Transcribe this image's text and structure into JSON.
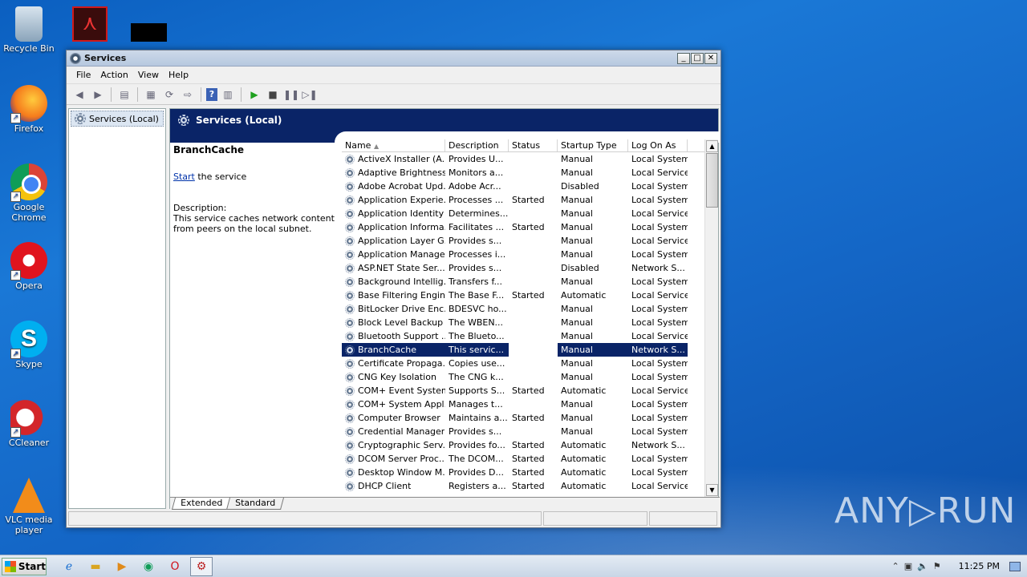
{
  "desktop": {
    "icons": [
      {
        "label": "Recycle Bin"
      },
      {
        "label": "Firefox"
      },
      {
        "label": "Google Chrome"
      },
      {
        "label": "Opera"
      },
      {
        "label": "Skype"
      },
      {
        "label": "CCleaner"
      },
      {
        "label": "VLC media player"
      }
    ],
    "watermark": "ANY▷RUN"
  },
  "window": {
    "title": "Services",
    "menu": [
      "File",
      "Action",
      "View",
      "Help"
    ],
    "tree_root": "Services (Local)",
    "pane_title": "Services (Local)",
    "extended": {
      "service_name": "BranchCache",
      "start_link": "Start",
      "start_suffix": " the service",
      "description_label": "Description:",
      "description_text": "This service caches network content from peers on the local subnet."
    },
    "columns": [
      "Name",
      "Description",
      "Status",
      "Startup Type",
      "Log On As"
    ],
    "rows": [
      {
        "name": "ActiveX Installer (A...",
        "desc": "Provides U...",
        "status": "",
        "startup": "Manual",
        "logon": "Local System"
      },
      {
        "name": "Adaptive Brightness",
        "desc": "Monitors a...",
        "status": "",
        "startup": "Manual",
        "logon": "Local Service"
      },
      {
        "name": "Adobe Acrobat Upd...",
        "desc": "Adobe Acr...",
        "status": "",
        "startup": "Disabled",
        "logon": "Local System"
      },
      {
        "name": "Application Experie...",
        "desc": "Processes ...",
        "status": "Started",
        "startup": "Manual",
        "logon": "Local System"
      },
      {
        "name": "Application Identity",
        "desc": "Determines...",
        "status": "",
        "startup": "Manual",
        "logon": "Local Service"
      },
      {
        "name": "Application Informa...",
        "desc": "Facilitates ...",
        "status": "Started",
        "startup": "Manual",
        "logon": "Local System"
      },
      {
        "name": "Application Layer G...",
        "desc": "Provides s...",
        "status": "",
        "startup": "Manual",
        "logon": "Local Service"
      },
      {
        "name": "Application Manage...",
        "desc": "Processes i...",
        "status": "",
        "startup": "Manual",
        "logon": "Local System"
      },
      {
        "name": "ASP.NET State Ser...",
        "desc": "Provides s...",
        "status": "",
        "startup": "Disabled",
        "logon": "Network S..."
      },
      {
        "name": "Background Intellig...",
        "desc": "Transfers f...",
        "status": "",
        "startup": "Manual",
        "logon": "Local System"
      },
      {
        "name": "Base Filtering Engine",
        "desc": "The Base F...",
        "status": "Started",
        "startup": "Automatic",
        "logon": "Local Service"
      },
      {
        "name": "BitLocker Drive Enc...",
        "desc": "BDESVC ho...",
        "status": "",
        "startup": "Manual",
        "logon": "Local System"
      },
      {
        "name": "Block Level Backup ...",
        "desc": "The WBEN...",
        "status": "",
        "startup": "Manual",
        "logon": "Local System"
      },
      {
        "name": "Bluetooth Support ...",
        "desc": "The Blueto...",
        "status": "",
        "startup": "Manual",
        "logon": "Local Service"
      },
      {
        "name": "BranchCache",
        "desc": "This servic...",
        "status": "",
        "startup": "Manual",
        "logon": "Network S..."
      },
      {
        "name": "Certificate Propaga...",
        "desc": "Copies use...",
        "status": "",
        "startup": "Manual",
        "logon": "Local System"
      },
      {
        "name": "CNG Key Isolation",
        "desc": "The CNG k...",
        "status": "",
        "startup": "Manual",
        "logon": "Local System"
      },
      {
        "name": "COM+ Event System",
        "desc": "Supports S...",
        "status": "Started",
        "startup": "Automatic",
        "logon": "Local Service"
      },
      {
        "name": "COM+ System Appl...",
        "desc": "Manages t...",
        "status": "",
        "startup": "Manual",
        "logon": "Local System"
      },
      {
        "name": "Computer Browser",
        "desc": "Maintains a...",
        "status": "Started",
        "startup": "Manual",
        "logon": "Local System"
      },
      {
        "name": "Credential Manager",
        "desc": "Provides s...",
        "status": "",
        "startup": "Manual",
        "logon": "Local System"
      },
      {
        "name": "Cryptographic Serv...",
        "desc": "Provides fo...",
        "status": "Started",
        "startup": "Automatic",
        "logon": "Network S..."
      },
      {
        "name": "DCOM Server Proc...",
        "desc": "The DCOM...",
        "status": "Started",
        "startup": "Automatic",
        "logon": "Local System"
      },
      {
        "name": "Desktop Window M...",
        "desc": "Provides D...",
        "status": "Started",
        "startup": "Automatic",
        "logon": "Local System"
      },
      {
        "name": "DHCP Client",
        "desc": "Registers a...",
        "status": "Started",
        "startup": "Automatic",
        "logon": "Local Service"
      }
    ],
    "tabs": [
      "Extended",
      "Standard"
    ]
  },
  "taskbar": {
    "start_label": "Start",
    "clock": "11:25 PM"
  }
}
